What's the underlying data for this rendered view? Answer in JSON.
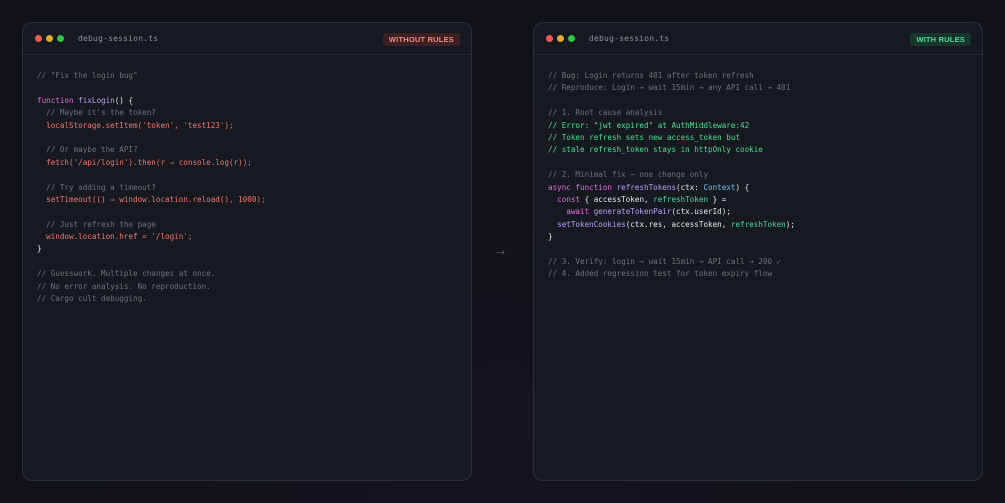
{
  "left": {
    "filename": "debug-session.ts",
    "badge": "WITHOUT RULES",
    "lines": [
      [
        {
          "t": "// \"Fix the login bug\"",
          "c": "c-comment"
        }
      ],
      [],
      [
        {
          "t": "function ",
          "c": "c-kw"
        },
        {
          "t": "fixLogin",
          "c": "c-fn"
        },
        {
          "t": "() {",
          "c": "c-plain"
        }
      ],
      [
        {
          "t": "  // Maybe it's the token?",
          "c": "c-comment"
        }
      ],
      [
        {
          "t": "  localStorage.setItem('token', 'test123');",
          "c": "c-red"
        }
      ],
      [],
      [
        {
          "t": "  // Or maybe the API?",
          "c": "c-comment"
        }
      ],
      [
        {
          "t": "  fetch('/api/login').then(r ⇒ console.log(r));",
          "c": "c-red"
        }
      ],
      [],
      [
        {
          "t": "  // Try adding a timeout?",
          "c": "c-comment"
        }
      ],
      [
        {
          "t": "  setTimeout(() ⇒ window.location.reload(), 1000);",
          "c": "c-red"
        }
      ],
      [],
      [
        {
          "t": "  // Just refresh the page",
          "c": "c-comment"
        }
      ],
      [
        {
          "t": "  window.location.href = '/login';",
          "c": "c-red"
        }
      ],
      [
        {
          "t": "}",
          "c": "c-plain"
        }
      ],
      [],
      [
        {
          "t": "// Guesswork. Multiple changes at once.",
          "c": "c-comment"
        }
      ],
      [
        {
          "t": "// No error analysis. No reproduction.",
          "c": "c-comment"
        }
      ],
      [
        {
          "t": "// Cargo cult debugging.",
          "c": "c-comment"
        }
      ]
    ]
  },
  "right": {
    "filename": "debug-session.ts",
    "badge": "WITH RULES",
    "lines": [
      [
        {
          "t": "// Bug: Login returns 401 after token refresh",
          "c": "c-comment"
        }
      ],
      [
        {
          "t": "// Reproduce: Login → wait 15min → any API call → 401",
          "c": "c-comment"
        }
      ],
      [],
      [
        {
          "t": "// 1. Root cause analysis",
          "c": "c-comment"
        }
      ],
      [
        {
          "t": "// Error: \"jwt expired\" at AuthMiddleware:42",
          "c": "c-green"
        }
      ],
      [
        {
          "t": "// Token refresh sets new access_token but",
          "c": "c-green"
        }
      ],
      [
        {
          "t": "// stale refresh_token stays in httpOnly cookie",
          "c": "c-green"
        }
      ],
      [],
      [
        {
          "t": "// 2. Minimal fix — one change only",
          "c": "c-comment"
        }
      ],
      [
        {
          "t": "async function ",
          "c": "c-kw"
        },
        {
          "t": "refreshTokens",
          "c": "c-fn"
        },
        {
          "t": "(ctx: ",
          "c": "c-plain"
        },
        {
          "t": "Context",
          "c": "c-type"
        },
        {
          "t": ") {",
          "c": "c-plain"
        }
      ],
      [
        {
          "t": "  const ",
          "c": "c-kw"
        },
        {
          "t": "{ accessToken, ",
          "c": "c-plain"
        },
        {
          "t": "refreshToken",
          "c": "c-teal"
        },
        {
          "t": " } =",
          "c": "c-plain"
        }
      ],
      [
        {
          "t": "    await ",
          "c": "c-kw"
        },
        {
          "t": "generateTokenPair",
          "c": "c-fn"
        },
        {
          "t": "(ctx.userId);",
          "c": "c-plain"
        }
      ],
      [
        {
          "t": "  setTokenCookies",
          "c": "c-fn"
        },
        {
          "t": "(ctx.res, accessToken, ",
          "c": "c-plain"
        },
        {
          "t": "refreshToken",
          "c": "c-teal"
        },
        {
          "t": ");",
          "c": "c-plain"
        }
      ],
      [
        {
          "t": "}",
          "c": "c-plain"
        }
      ],
      [],
      [
        {
          "t": "// 3. Verify: login → wait 15min → API call → 200 ✓",
          "c": "c-comment"
        }
      ],
      [
        {
          "t": "// 4. Added regression test for token expiry flow",
          "c": "c-comment"
        }
      ]
    ]
  },
  "divider_arrow": "→"
}
